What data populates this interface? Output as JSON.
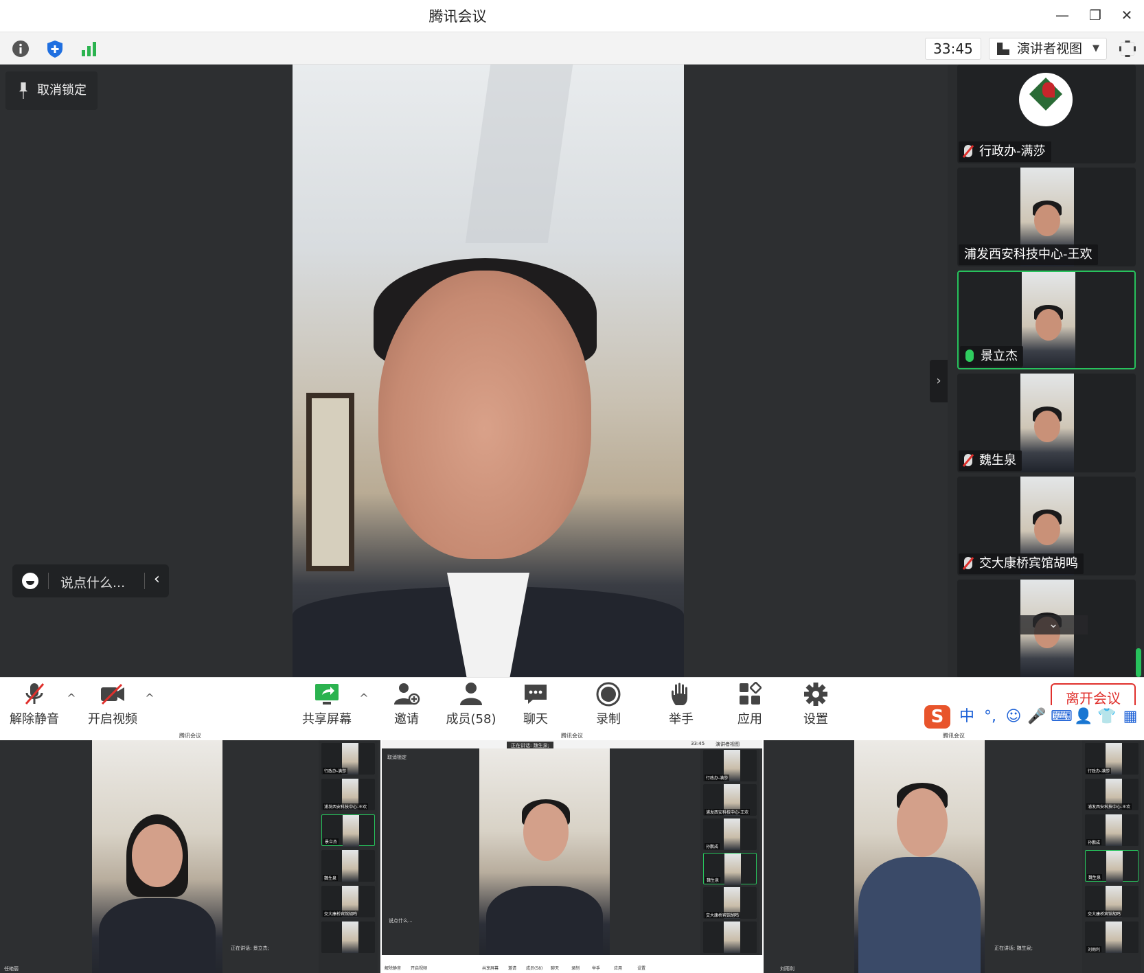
{
  "window": {
    "title": "腾讯会议",
    "minimize": "—",
    "restore": "❐",
    "close": "✕"
  },
  "topbar": {
    "timer": "33:45",
    "view_label": "演讲者视图",
    "view_caret": "▼"
  },
  "stage": {
    "unpin_label": "取消锁定",
    "chat_placeholder": "说点什么...",
    "chat_back": "‹",
    "collapse_arrow": "›"
  },
  "sidebar": {
    "participants": [
      {
        "name": "行政办-满莎",
        "mic": "muted",
        "avatar": "logo"
      },
      {
        "name": "浦发西安科技中心-王欢",
        "mic": "none",
        "avatar": "camera"
      },
      {
        "name": "景立杰",
        "mic": "on",
        "avatar": "camera",
        "active": true
      },
      {
        "name": "魏生泉",
        "mic": "muted",
        "avatar": "camera"
      },
      {
        "name": "交大康桥宾馆胡鸣",
        "mic": "muted",
        "avatar": "camera"
      },
      {
        "name": "",
        "mic": "none",
        "avatar": "camera"
      }
    ],
    "scroll_down": "⌄"
  },
  "controls": {
    "unmute": "解除静音",
    "start_video": "开启视频",
    "share_screen": "共享屏幕",
    "invite": "邀请",
    "members": "成员(58)",
    "chat": "聊天",
    "record": "录制",
    "raise_hand": "举手",
    "apps": "应用",
    "settings": "设置",
    "leave": "离开会议",
    "caret": "^"
  },
  "ime": {
    "logo": "S",
    "items": [
      "中",
      "°,",
      "☺",
      "🎤",
      "⌨",
      "👤",
      "👕",
      "▦"
    ]
  },
  "thumbnails": [
    {
      "title": "腾讯会议",
      "speaking": "正在讲话: 景立杰;",
      "tiles": [
        "行政办-满莎",
        "浦发西安科技中心-王欢",
        "景立杰",
        "魏生泉",
        "交大康桥宾馆胡鸣",
        ""
      ],
      "footer_name": "任艳丽"
    },
    {
      "title": "腾讯会议",
      "speaking": "正在讲话: 魏生泉;",
      "tiles": [
        "行政办-满莎",
        "浦发西安科技中心-王欢",
        "孙鹏成",
        "魏生泉",
        "交大康桥宾馆胡鸣",
        ""
      ],
      "timer": "33:45",
      "view": "演讲者视图",
      "unpin": "取消锁定",
      "chat": "说点什么...",
      "bar": [
        "解除静音",
        "开启视频",
        "共享屏幕",
        "邀请",
        "成员(58)",
        "聊天",
        "录制",
        "举手",
        "应用",
        "设置"
      ],
      "footer_name": ""
    },
    {
      "title": "腾讯会议",
      "speaking": "正在讲话: 魏生泉;",
      "tiles": [
        "行政办-满莎",
        "浦发西安科技中心-王欢",
        "孙鹏成",
        "魏生泉",
        "交大康桥宾馆胡鸣",
        "刘雨利"
      ],
      "footer_name": "刘雨利"
    }
  ],
  "colors": {
    "stage_bg": "#2d2f31",
    "sidebar_bg": "#2a2c2e",
    "active_border": "#27c25c",
    "mute_red": "#e0302c",
    "leave_red": "#e0302c"
  }
}
